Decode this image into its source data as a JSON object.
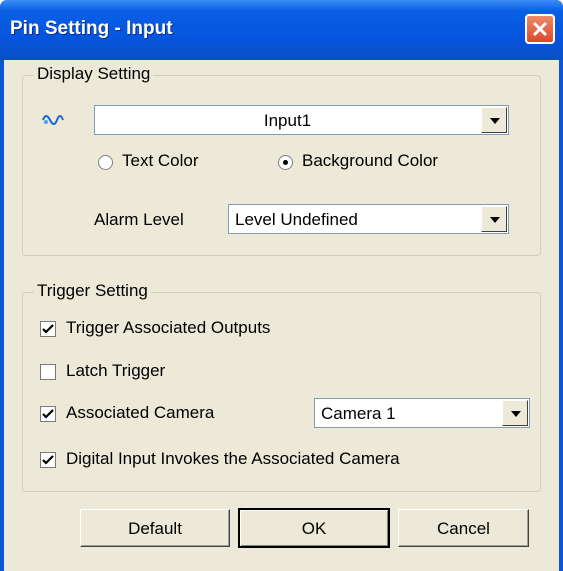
{
  "window": {
    "title": "Pin Setting - Input"
  },
  "display_setting": {
    "legend": "Display Setting",
    "input_select": {
      "value": "Input1",
      "icon": "signal-wave-icon"
    },
    "radio_text_color": {
      "label": "Text Color",
      "selected": false
    },
    "radio_background_color": {
      "label": "Background Color",
      "selected": true
    },
    "alarm_level": {
      "label": "Alarm Level",
      "value": "Level Undefined"
    }
  },
  "trigger_setting": {
    "legend": "Trigger Setting",
    "trigger_associated_outputs": {
      "label": "Trigger Associated Outputs",
      "checked": true
    },
    "latch_trigger": {
      "label": "Latch Trigger",
      "checked": false
    },
    "associated_camera": {
      "label": "Associated Camera",
      "checked": true,
      "value": "Camera 1"
    },
    "digital_input_invokes": {
      "label": "Digital Input Invokes the Associated Camera",
      "checked": true
    }
  },
  "buttons": {
    "default": "Default",
    "ok": "OK",
    "cancel": "Cancel"
  },
  "colors": {
    "titlebar": "#0a55d8",
    "face": "#ece9d8",
    "close": "#d8492a"
  }
}
